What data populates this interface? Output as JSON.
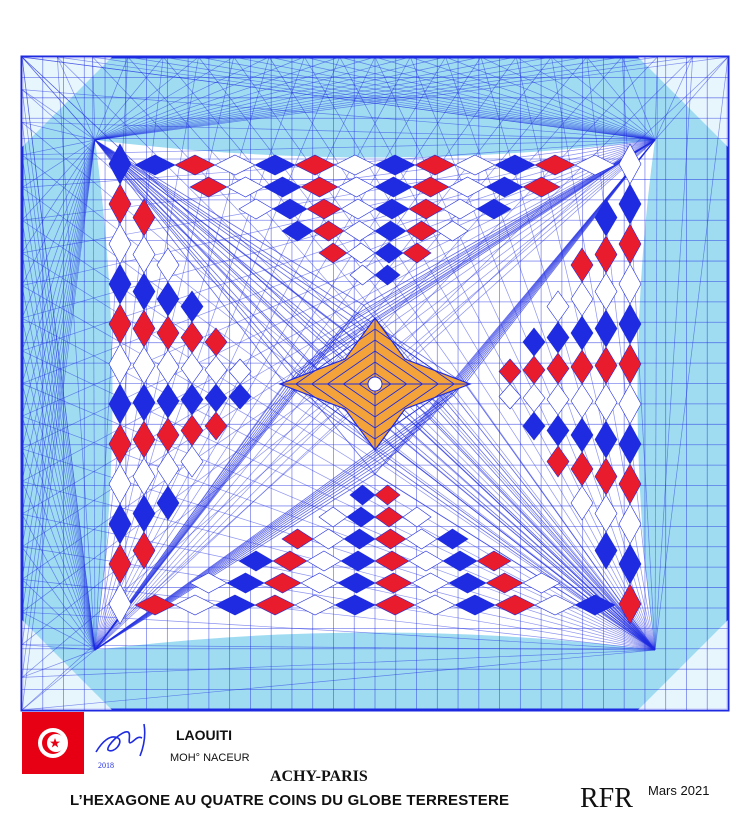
{
  "artwork": {
    "colors": {
      "blue": "#1e2be0",
      "light_blue": "#9fdcf2",
      "red": "#e81c2c",
      "orange": "#f4a33a",
      "white": "#ffffff"
    }
  },
  "caption": {
    "name": "LAOUITI",
    "name_line2": "MOH° NACEUR",
    "signature": "2018",
    "organization": "ACHY-PARIS",
    "title": "L’HEXAGONE AU QUATRE COINS DU GLOBE TERRESTERE",
    "logo": "RFR",
    "date": "Mars 2021"
  },
  "flag": {
    "country": "Tunisia",
    "color": "#e70013"
  }
}
